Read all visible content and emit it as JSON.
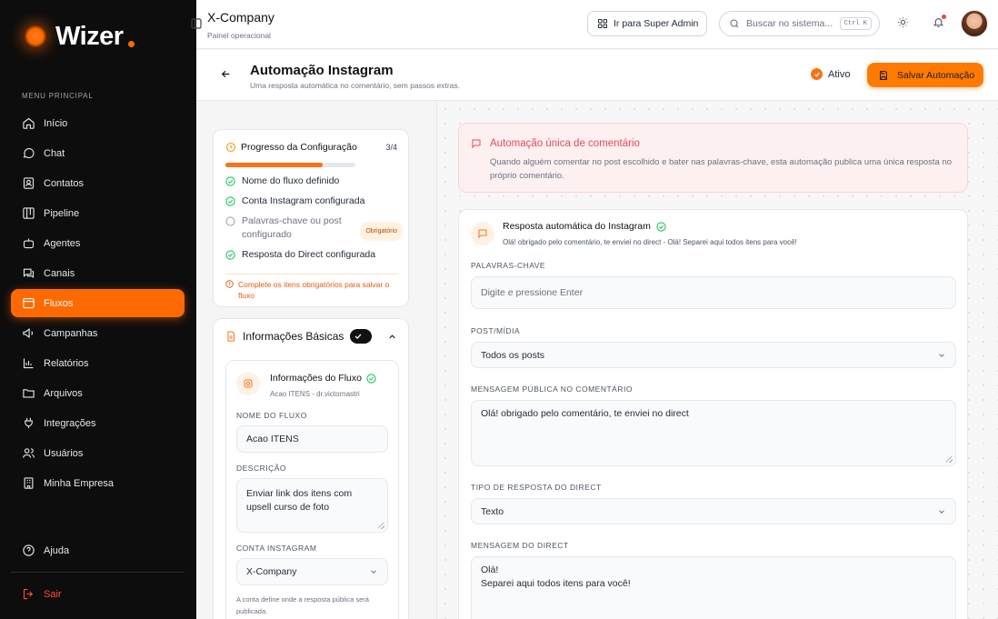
{
  "brand": {
    "name": "Wizer"
  },
  "sidebar": {
    "menu_label": "MENU PRINCIPAL",
    "items": [
      {
        "label": "Início",
        "icon": "home-icon"
      },
      {
        "label": "Chat",
        "icon": "chat-icon"
      },
      {
        "label": "Contatos",
        "icon": "contacts-icon"
      },
      {
        "label": "Pipeline",
        "icon": "pipeline-icon"
      },
      {
        "label": "Agentes",
        "icon": "agents-icon"
      },
      {
        "label": "Canais",
        "icon": "channels-icon"
      },
      {
        "label": "Fluxos",
        "icon": "flows-icon",
        "active": true
      },
      {
        "label": "Campanhas",
        "icon": "megaphone-icon"
      },
      {
        "label": "Relatórios",
        "icon": "chart-icon"
      },
      {
        "label": "Arquivos",
        "icon": "folder-icon"
      },
      {
        "label": "Integrações",
        "icon": "plug-icon"
      },
      {
        "label": "Usuários",
        "icon": "users-icon"
      },
      {
        "label": "Minha Empresa",
        "icon": "building-icon"
      }
    ],
    "help_label": "Ajuda",
    "logout_label": "Sair"
  },
  "topbar": {
    "company": "X-Company",
    "subtitle": "Painel operacional",
    "super_admin_label": "Ir para Super Admin",
    "search_placeholder": "Buscar no sistema...",
    "search_shortcut": "Ctrl K"
  },
  "page": {
    "title": "Automação Instagram",
    "subtitle": "Uma resposta automática no comentário, sem passos extras.",
    "status_label": "Ativo",
    "save_label": "Salvar Automação"
  },
  "progress": {
    "title": "Progresso da Configuração",
    "count": "3/4",
    "fraction": 0.75,
    "items": [
      {
        "label": "Nome do fluxo definido",
        "done": true
      },
      {
        "label": "Conta Instagram configurada",
        "done": true
      },
      {
        "label": "Palavras-chave ou post configurado",
        "done": false,
        "badge": "Obrigatório"
      },
      {
        "label": "Resposta do Direct configurada",
        "done": true
      }
    ],
    "warning": "Complete os itens obrigatórios para salvar o fluxo"
  },
  "basic_info": {
    "title": "Informações Básicas",
    "card_title": "Informações do Fluxo",
    "card_subtitle": "Acao ITENS - dr.victornastri",
    "name_label": "NOME DO FLUXO",
    "name_value": "Acao ITENS",
    "desc_label": "DESCRIÇÃO",
    "desc_value": "Enviar link dos itens com upsell curso de foto",
    "account_label": "CONTA INSTAGRAM",
    "account_value": "X-Company",
    "account_hint": "A conta define onde a resposta pública será publicada."
  },
  "alert": {
    "title": "Automação única de comentário",
    "text": "Quando alguém comentar no post escolhido e bater nas palavras-chave, esta automação publica uma única resposta no próprio comentário."
  },
  "response": {
    "title": "Resposta automática do Instagram",
    "subtitle": "Olá! obrigado pelo comentário, te enviei no direct - Olá! Separei aqui todos itens para você!",
    "keywords_label": "PALAVRAS-CHAVE",
    "keywords_placeholder": "Digite e pressione Enter",
    "post_label": "POST/MÍDIA",
    "post_value": "Todos os posts",
    "public_msg_label": "MENSAGEM PÚBLICA NO COMENTÁRIO",
    "public_msg_value": "Olá! obrigado pelo comentário, te enviei no direct",
    "direct_type_label": "TIPO DE RESPOSTA DO DIRECT",
    "direct_type_value": "Texto",
    "direct_msg_label": "MENSAGEM DO DIRECT",
    "direct_msg_value": "Olá!\nSeparei aqui todos itens para você!"
  },
  "colors": {
    "accent": "#ff6a00",
    "success": "#22c55e",
    "alert": "#e64a5a"
  }
}
